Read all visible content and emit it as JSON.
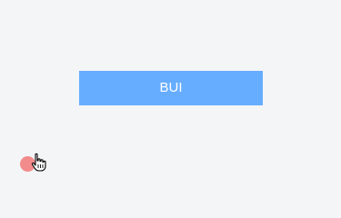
{
  "button": {
    "label": "BUI",
    "color": "#66adff",
    "text_color": "#ffffff"
  },
  "background_color": "#f4f5f7",
  "touch_indicator": {
    "color": "#f28b8b"
  },
  "cursor": {
    "icon": "hand-pointer-icon"
  }
}
